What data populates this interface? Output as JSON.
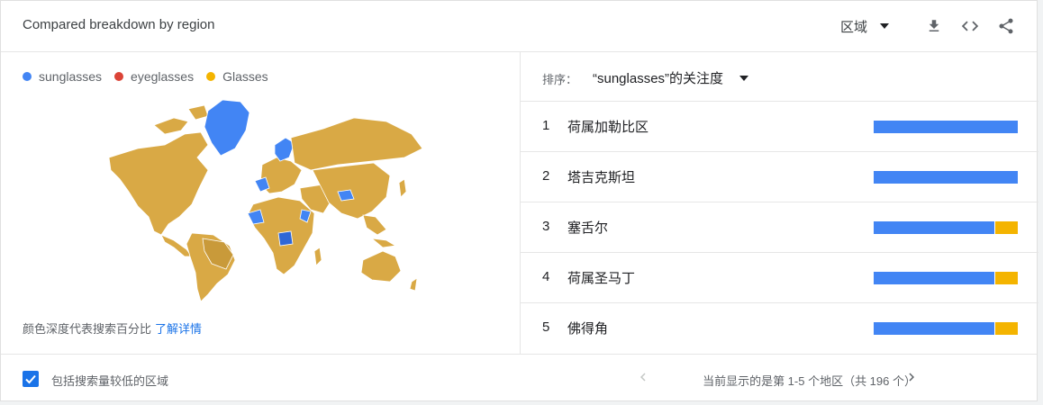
{
  "header": {
    "title": "Compared breakdown by region",
    "region_select": "区域"
  },
  "legend": [
    {
      "label": "sunglasses",
      "color": "#4285f4"
    },
    {
      "label": "eyeglasses",
      "color": "#db4437"
    },
    {
      "label": "Glasses",
      "color": "#f4b400"
    }
  ],
  "note": {
    "text": "颜色深度代表搜索百分比",
    "link": "了解详情"
  },
  "sort": {
    "label": "排序：",
    "value": "“sunglasses”的关注度"
  },
  "regions": [
    {
      "rank": "1",
      "name": "荷属加勒比区",
      "shares": [
        100,
        0,
        0
      ]
    },
    {
      "rank": "2",
      "name": "塔吉克斯坦",
      "shares": [
        100,
        0,
        0
      ]
    },
    {
      "rank": "3",
      "name": "塞舌尔",
      "shares": [
        84,
        0,
        16
      ]
    },
    {
      "rank": "4",
      "name": "荷属圣马丁",
      "shares": [
        84,
        0,
        16
      ]
    },
    {
      "rank": "5",
      "name": "佛得角",
      "shares": [
        84,
        0,
        16
      ]
    }
  ],
  "footer": {
    "checkbox_label": "包括搜索量较低的区域",
    "checkbox_checked": true,
    "pagination": "当前显示的是第 1-5 个地区（共 196 个）"
  },
  "icons": [
    "download-icon",
    "embed-code-icon",
    "share-icon",
    "chevron-left-icon",
    "chevron-right-icon",
    "check-icon"
  ]
}
